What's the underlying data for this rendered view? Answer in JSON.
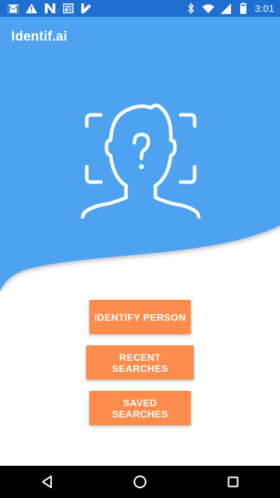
{
  "status_bar": {
    "time": "3:01",
    "left_icons": [
      "gmail-icon",
      "warning-icon",
      "n-app-icon",
      "news-icon",
      "check-app-icon"
    ],
    "right_icons": [
      "bluetooth-icon",
      "wifi-icon",
      "signal-icon",
      "battery-icon"
    ]
  },
  "app": {
    "title": "Identif.ai"
  },
  "buttons": {
    "identify_label": "IDENTIFY PERSON",
    "recent_label": "RECENT SEARCHES",
    "saved_label": "SAVED SEARCHES"
  },
  "nav": {
    "items": [
      "back-icon",
      "home-icon",
      "recents-icon"
    ]
  },
  "colors": {
    "status_bar": "#1f6fd0",
    "hero_blue": "#4da3f0",
    "button_orange": "#fb8c4b",
    "nav_bar": "#000000"
  }
}
